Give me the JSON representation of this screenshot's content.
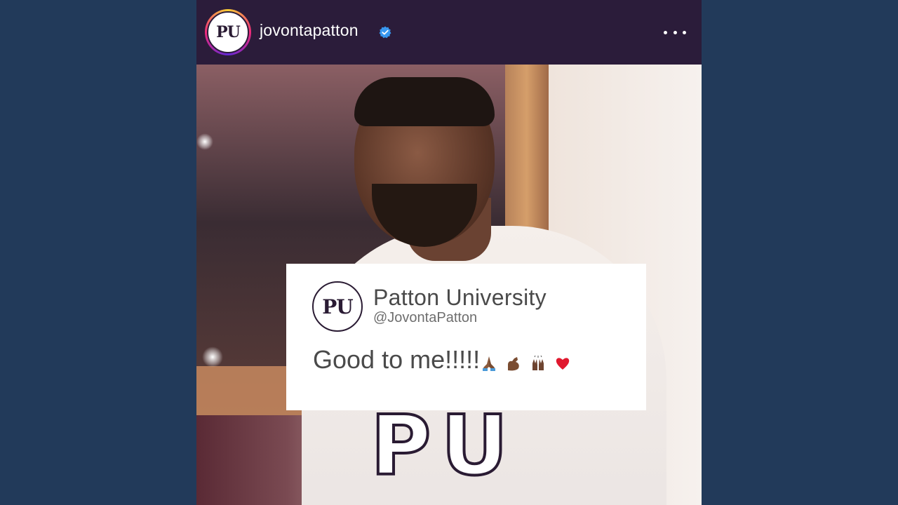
{
  "post": {
    "username": "jovontapatton",
    "avatar_text": "PU",
    "verified_icon": "verified-badge-icon",
    "more_icon": "more-options-icon",
    "shirt_text": "PU"
  },
  "tweet": {
    "avatar_text": "PU",
    "name": "Patton University",
    "handle": "@JovontaPatton",
    "text": "Good to me!!!!!",
    "emojis": [
      "folded-hands-icon",
      "flexed-biceps-icon",
      "raising-hands-icon",
      "red-heart-icon"
    ]
  },
  "colors": {
    "background": "#223a5a",
    "header": "#2b1c3a",
    "verified": "#3897f0",
    "heart": "#e0182e"
  }
}
